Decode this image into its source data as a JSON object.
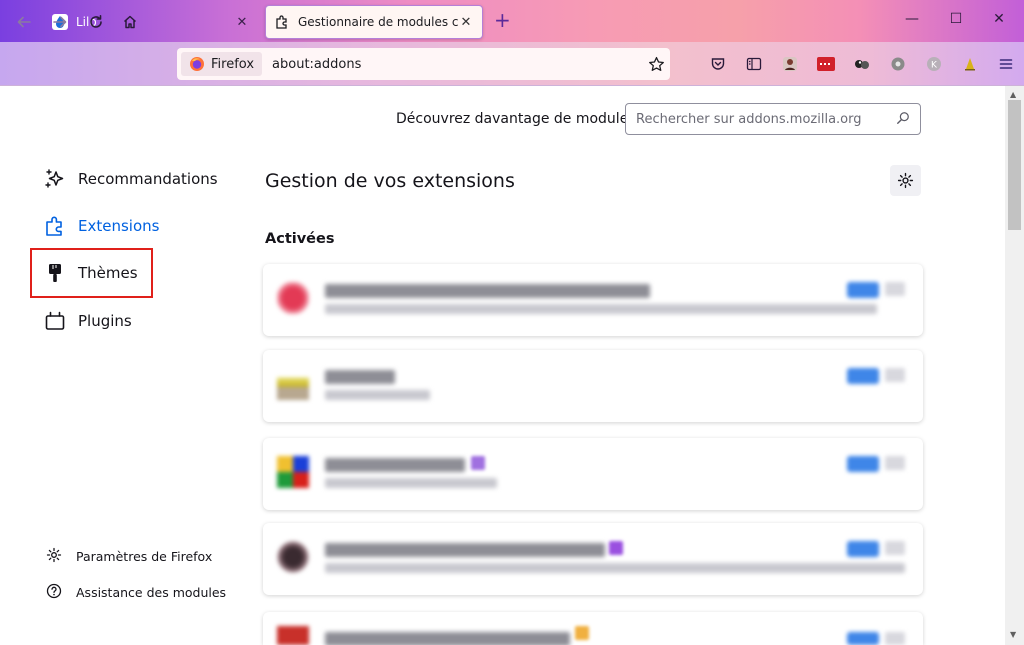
{
  "tabs": [
    {
      "title": "Lilo",
      "active": false
    },
    {
      "title": "Gestionnaire de modules compl",
      "active": true
    }
  ],
  "urlbar": {
    "identity_label": "Firefox",
    "url": "about:addons"
  },
  "header": {
    "discover_label": "Découvrez davantage de modules",
    "search_placeholder": "Rechercher sur addons.mozilla.org"
  },
  "sidebar": {
    "items": [
      {
        "label": "Recommandations",
        "icon": "sparkle-icon"
      },
      {
        "label": "Extensions",
        "icon": "puzzle-icon",
        "active": true
      },
      {
        "label": "Thèmes",
        "icon": "brush-icon",
        "highlighted": true
      },
      {
        "label": "Plugins",
        "icon": "plugin-icon"
      }
    ],
    "footer": [
      {
        "label": "Paramètres de Firefox",
        "icon": "gear-icon"
      },
      {
        "label": "Assistance des modules",
        "icon": "help-icon"
      }
    ]
  },
  "main": {
    "heading": "Gestion de vos extensions",
    "section_label": "Activées"
  },
  "colors": {
    "accent": "#0061e0",
    "highlight": "#e0201a"
  }
}
